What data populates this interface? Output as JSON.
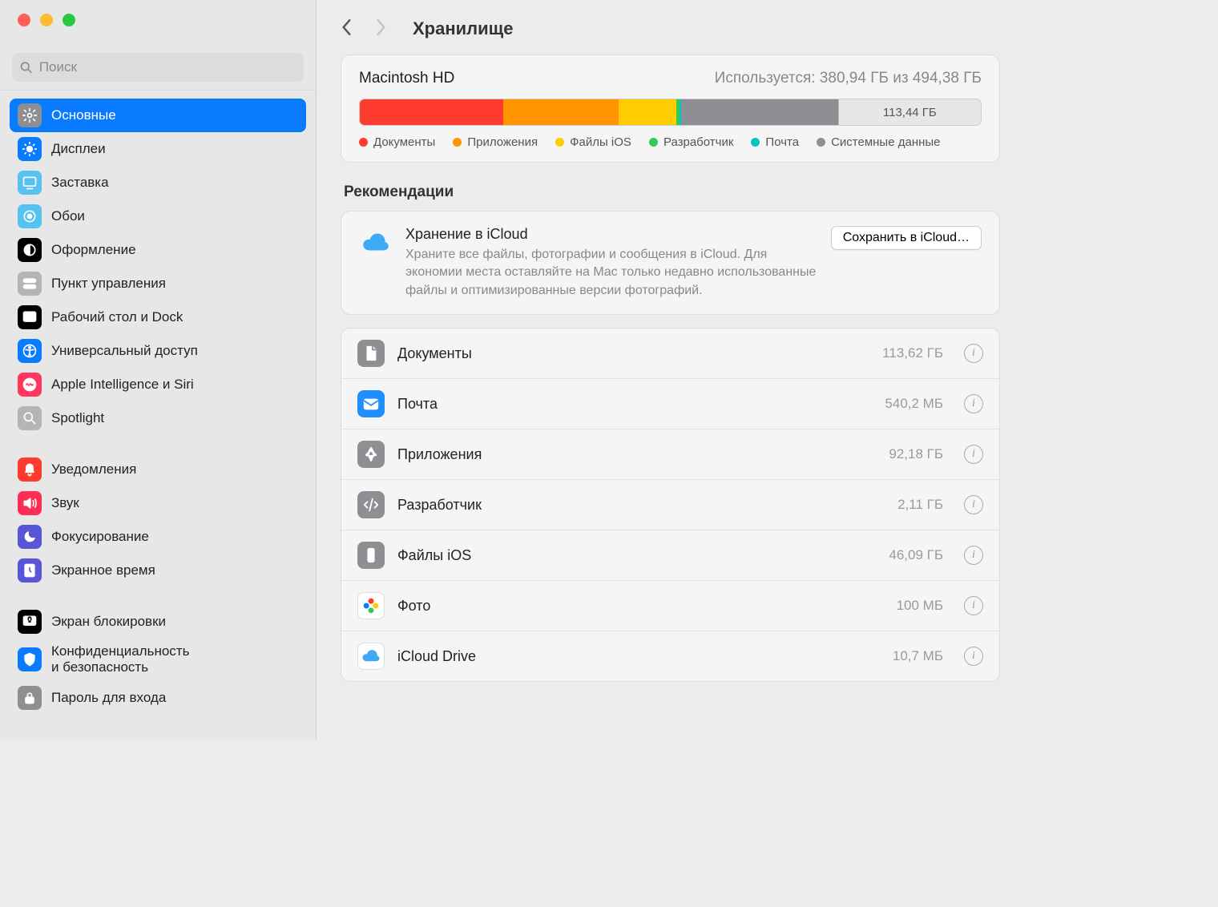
{
  "search": {
    "placeholder": "Поиск"
  },
  "sidebar": {
    "groups": [
      [
        {
          "label": "Основные",
          "icon": "gear",
          "bg": "#8e8e93",
          "selected": true
        },
        {
          "label": "Дисплеи",
          "icon": "brightness",
          "bg": "#0a7aff"
        },
        {
          "label": "Заставка",
          "icon": "screensaver",
          "bg": "#55c2f0"
        },
        {
          "label": "Обои",
          "icon": "wallpaper",
          "bg": "#55c2f0"
        },
        {
          "label": "Оформление",
          "icon": "appearance",
          "bg": "#000000"
        },
        {
          "label": "Пункт управления",
          "icon": "control-center",
          "bg": "#b5b5b8"
        },
        {
          "label": "Рабочий стол и Dock",
          "icon": "dock",
          "bg": "#000000"
        },
        {
          "label": "Универсальный доступ",
          "icon": "accessibility",
          "bg": "#0a7aff"
        },
        {
          "label": "Apple Intelligence и Siri",
          "icon": "siri",
          "bg": "#ff375f"
        },
        {
          "label": "Spotlight",
          "icon": "spotlight",
          "bg": "#b5b5b8"
        }
      ],
      [
        {
          "label": "Уведомления",
          "icon": "bell",
          "bg": "#ff3b30"
        },
        {
          "label": "Звук",
          "icon": "sound",
          "bg": "#ff2d55"
        },
        {
          "label": "Фокусирование",
          "icon": "focus",
          "bg": "#5856d6"
        },
        {
          "label": "Экранное время",
          "icon": "screentime",
          "bg": "#5856d6"
        }
      ],
      [
        {
          "label": "Экран блокировки",
          "icon": "lock",
          "bg": "#000000"
        },
        {
          "label": "Конфиденциальность\nи безопасность",
          "icon": "privacy",
          "bg": "#0a7aff"
        },
        {
          "label": "Пароль для входа",
          "icon": "password",
          "bg": "#8e8e93"
        }
      ]
    ]
  },
  "header": {
    "title": "Хранилище"
  },
  "disk": {
    "name": "Macintosh HD",
    "used_label": "Используется: 380,94 ГБ из 494,38 ГБ",
    "segments": [
      {
        "color": "#ff3b30",
        "pct": 23.1
      },
      {
        "color": "#ff9500",
        "pct": 18.6
      },
      {
        "color": "#ffcc00",
        "pct": 9.3
      },
      {
        "color": "#34c759",
        "pct": 0.5
      },
      {
        "color": "#00c7be",
        "pct": 0.2
      },
      {
        "color": "#8e8e93",
        "pct": 25.3
      },
      {
        "color": "#e7e7e7",
        "pct": 23.0,
        "label": "113,44 ГБ"
      }
    ],
    "legend": [
      {
        "color": "#ff3b30",
        "label": "Документы"
      },
      {
        "color": "#ff9500",
        "label": "Приложения"
      },
      {
        "color": "#ffcc00",
        "label": "Файлы iOS"
      },
      {
        "color": "#34c759",
        "label": "Разработчик"
      },
      {
        "color": "#00c7be",
        "label": "Почта"
      },
      {
        "color": "#8e8e93",
        "label": "Системные данные"
      }
    ]
  },
  "recommendations": {
    "heading": "Рекомендации",
    "title": "Хранение в iCloud",
    "desc": "Храните все файлы, фотографии и сообщения в iCloud. Для экономии места оставляйте на Mac только недавно использованные файлы и оптимизированные версии фотографий.",
    "button": "Сохранить в iCloud…"
  },
  "categories": [
    {
      "label": "Документы",
      "size": "113,62 ГБ",
      "bg": "#8e8e93",
      "icon": "doc"
    },
    {
      "label": "Почта",
      "size": "540,2 МБ",
      "bg": "#1f8fff",
      "icon": "mail"
    },
    {
      "label": "Приложения",
      "size": "92,18 ГБ",
      "bg": "#8e8e93",
      "icon": "apps"
    },
    {
      "label": "Разработчик",
      "size": "2,11 ГБ",
      "bg": "#8e8e93",
      "icon": "dev"
    },
    {
      "label": "Файлы iOS",
      "size": "46,09 ГБ",
      "bg": "#8e8e93",
      "icon": "ios"
    },
    {
      "label": "Фото",
      "size": "100 МБ",
      "bg": "#ffffff",
      "icon": "photo"
    },
    {
      "label": "iCloud Drive",
      "size": "10,7 МБ",
      "bg": "#ffffff",
      "icon": "icloud"
    }
  ]
}
